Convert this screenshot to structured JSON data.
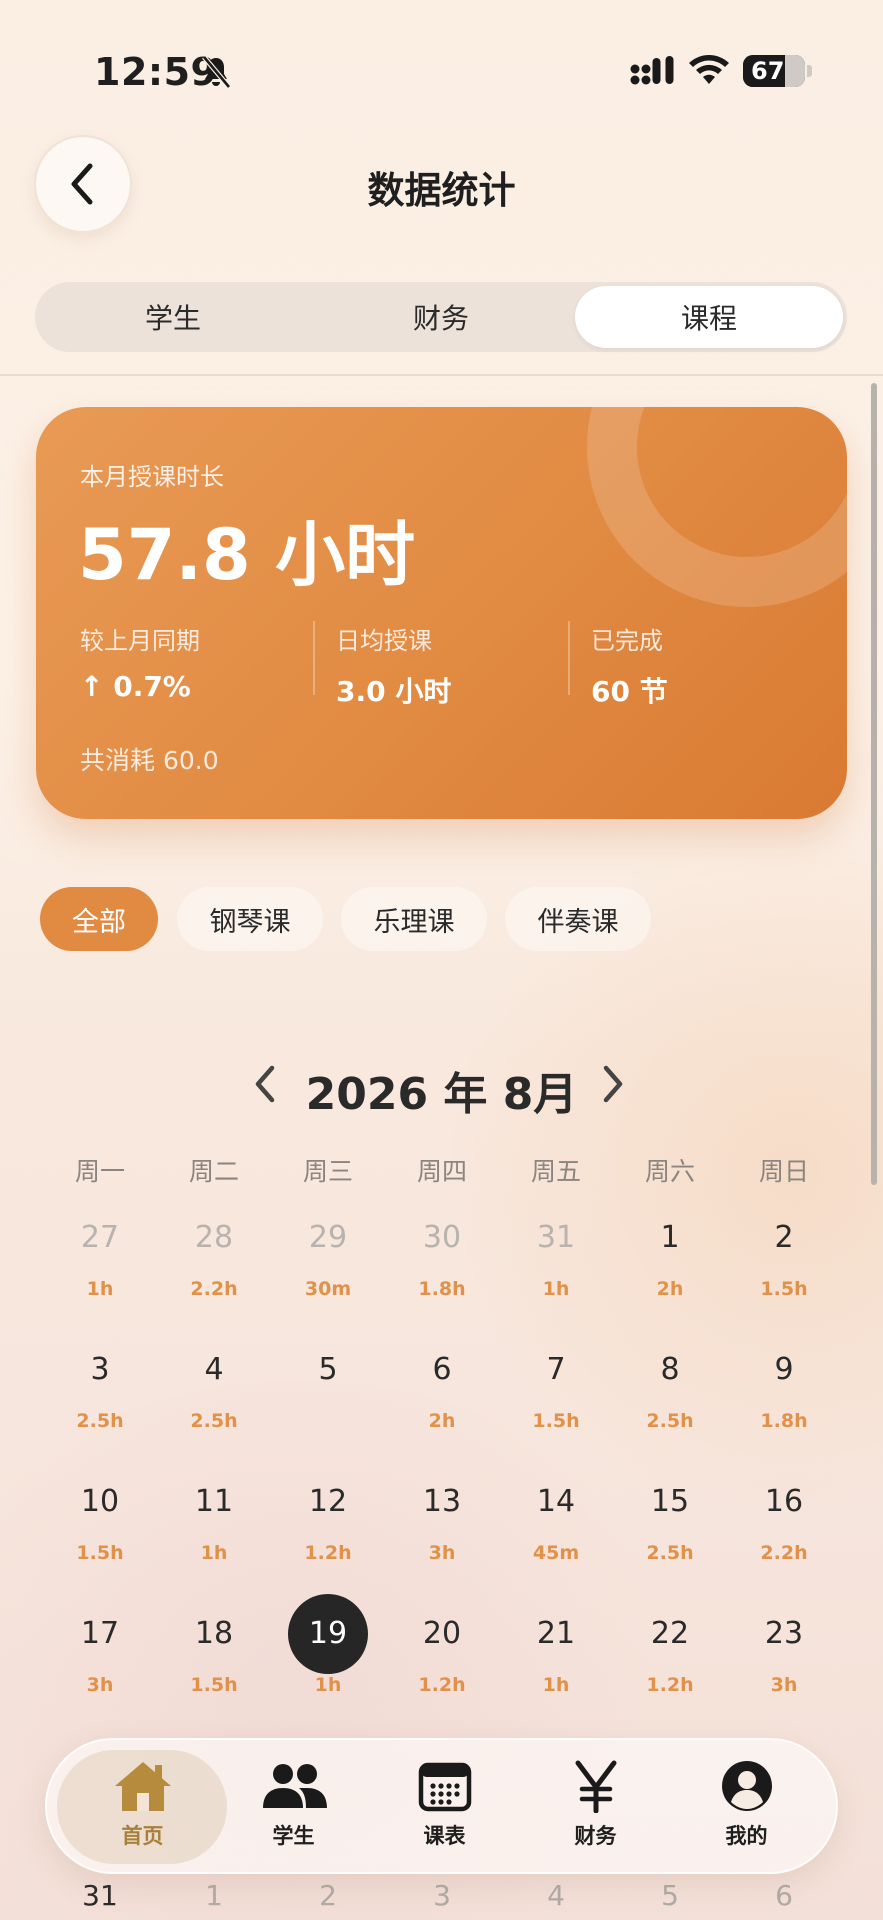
{
  "status": {
    "time": "12:59",
    "battery": "67",
    "battery_level": 0.67
  },
  "header": {
    "title": "数据统计"
  },
  "segments": [
    {
      "label": "学生",
      "active": false
    },
    {
      "label": "财务",
      "active": false
    },
    {
      "label": "课程",
      "active": true
    }
  ],
  "summary": {
    "label": "本月授课时长",
    "value": "57.8 小时",
    "stats": [
      {
        "label": "较上月同期",
        "value": "↑ 0.7%"
      },
      {
        "label": "日均授课",
        "value": "3.0 小时"
      },
      {
        "label": "已完成",
        "value": "60 节"
      }
    ],
    "footer": "共消耗 60.0"
  },
  "filters": [
    {
      "label": "全部",
      "active": true
    },
    {
      "label": "钢琴课",
      "active": false
    },
    {
      "label": "乐理课",
      "active": false
    },
    {
      "label": "伴奏课",
      "active": false
    }
  ],
  "calendar": {
    "month_label": "2026 年 8月",
    "weekdays": [
      "周一",
      "周二",
      "周三",
      "周四",
      "周五",
      "周六",
      "周日"
    ],
    "weeks": [
      [
        {
          "day": "27",
          "hours": "1h",
          "muted": true
        },
        {
          "day": "28",
          "hours": "2.2h",
          "muted": true
        },
        {
          "day": "29",
          "hours": "30m",
          "muted": true
        },
        {
          "day": "30",
          "hours": "1.8h",
          "muted": true
        },
        {
          "day": "31",
          "hours": "1h",
          "muted": true
        },
        {
          "day": "1",
          "hours": "2h"
        },
        {
          "day": "2",
          "hours": "1.5h"
        }
      ],
      [
        {
          "day": "3",
          "hours": "2.5h"
        },
        {
          "day": "4",
          "hours": "2.5h"
        },
        {
          "day": "5",
          "hours": ""
        },
        {
          "day": "6",
          "hours": "2h"
        },
        {
          "day": "7",
          "hours": "1.5h"
        },
        {
          "day": "8",
          "hours": "2.5h"
        },
        {
          "day": "9",
          "hours": "1.8h"
        }
      ],
      [
        {
          "day": "10",
          "hours": "1.5h"
        },
        {
          "day": "11",
          "hours": "1h"
        },
        {
          "day": "12",
          "hours": "1.2h"
        },
        {
          "day": "13",
          "hours": "3h"
        },
        {
          "day": "14",
          "hours": "45m"
        },
        {
          "day": "15",
          "hours": "2.5h"
        },
        {
          "day": "16",
          "hours": "2.2h"
        }
      ],
      [
        {
          "day": "17",
          "hours": "3h"
        },
        {
          "day": "18",
          "hours": "1.5h"
        },
        {
          "day": "19",
          "hours": "1h",
          "today": true
        },
        {
          "day": "20",
          "hours": "1.2h"
        },
        {
          "day": "21",
          "hours": "1h"
        },
        {
          "day": "22",
          "hours": "1.2h"
        },
        {
          "day": "23",
          "hours": "3h"
        }
      ]
    ],
    "partial_week": [
      {
        "day": "31",
        "muted": false
      },
      {
        "day": "1",
        "muted": true
      },
      {
        "day": "2",
        "muted": true
      },
      {
        "day": "3",
        "muted": true
      },
      {
        "day": "4",
        "muted": true
      },
      {
        "day": "5",
        "muted": true
      },
      {
        "day": "6",
        "muted": true
      }
    ]
  },
  "tabbar": [
    {
      "label": "首页",
      "icon": "home-icon",
      "active": true
    },
    {
      "label": "学生",
      "icon": "users-icon",
      "active": false
    },
    {
      "label": "课表",
      "icon": "calendar-icon",
      "active": false
    },
    {
      "label": "财务",
      "icon": "yen-icon",
      "active": false
    },
    {
      "label": "我的",
      "icon": "profile-icon",
      "active": false
    }
  ],
  "colors": {
    "accent": "#e18a42",
    "hours": "#e0924a",
    "active_tab": "#a6813b",
    "today": "#262626"
  }
}
